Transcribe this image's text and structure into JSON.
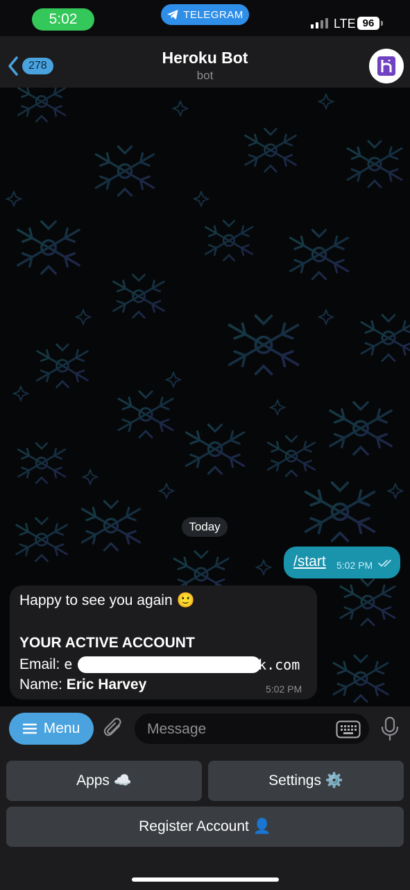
{
  "status_bar": {
    "time": "5:02",
    "app_pill": "TELEGRAM",
    "network": "LTE",
    "battery": "96"
  },
  "header": {
    "back_count": "278",
    "title": "Heroku Bot",
    "subtitle": "bot"
  },
  "chat": {
    "date_label": "Today",
    "messages": [
      {
        "direction": "out",
        "text": "/start",
        "time": "5:02 PM"
      },
      {
        "direction": "in",
        "line1": "Happy to see you again 🙂",
        "heading": "YOUR ACTIVE ACCOUNT",
        "email_label": "Email:",
        "email_prefix": "e",
        "email_suffix": "ok.com",
        "name_label": "Name:",
        "name_value": "Eric Harvey",
        "time": "5:02 PM"
      }
    ]
  },
  "composer": {
    "menu_label": "Menu",
    "placeholder": "Message"
  },
  "keyboard": {
    "buttons": [
      {
        "label": "Apps ☁️"
      },
      {
        "label": "Settings ⚙️"
      },
      {
        "label": "Register Account 👤"
      }
    ]
  },
  "colors": {
    "accent": "#4aa3df",
    "outgoing_bubble": "#1a93ad",
    "incoming_bubble": "#1c1c1e",
    "status_green": "#34c759",
    "telegram_blue": "#2f8ee8",
    "heroku_purple": "#6f42c1"
  }
}
